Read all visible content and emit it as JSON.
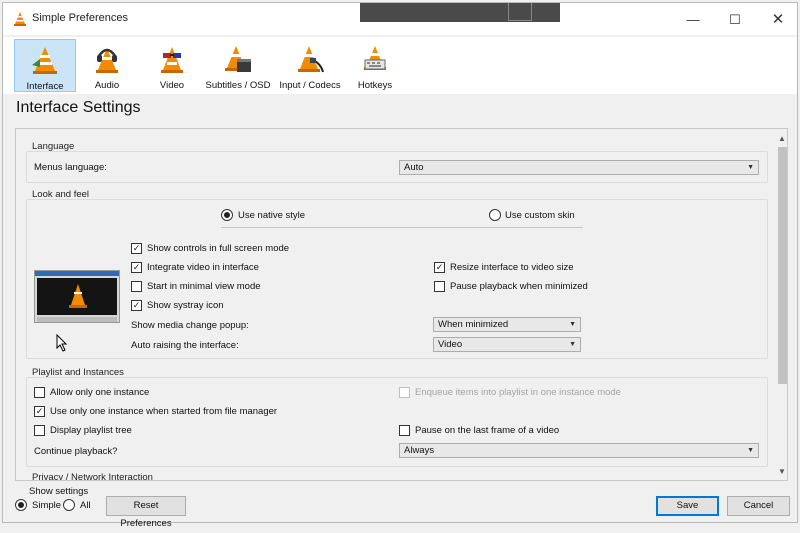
{
  "window": {
    "title": "Simple Preferences"
  },
  "toolbar": {
    "items": [
      {
        "label": "Interface",
        "icon": "cone-interface-icon"
      },
      {
        "label": "Audio",
        "icon": "cone-headphones-icon"
      },
      {
        "label": "Video",
        "icon": "cone-glasses-icon"
      },
      {
        "label": "Subtitles / OSD",
        "icon": "cone-clapper-icon"
      },
      {
        "label": "Input / Codecs",
        "icon": "cone-plug-icon"
      },
      {
        "label": "Hotkeys",
        "icon": "cone-keyboard-icon"
      }
    ]
  },
  "page": {
    "title": "Interface Settings"
  },
  "language": {
    "section": "Language",
    "menus_label": "Menus language:",
    "menus_value": "Auto"
  },
  "look": {
    "section": "Look and feel",
    "native_style": "Use native style",
    "custom_skin": "Use custom skin",
    "fullscreen_controls": "Show controls in full screen mode",
    "integrate_video": "Integrate video in interface",
    "resize_interface": "Resize interface to video size",
    "minimal_view": "Start in minimal view mode",
    "pause_minimized": "Pause playback when minimized",
    "systray": "Show systray icon",
    "media_popup_label": "Show media change popup:",
    "media_popup_value": "When minimized",
    "auto_raise_label": "Auto raising the interface:",
    "auto_raise_value": "Video"
  },
  "playlist": {
    "section": "Playlist and Instances",
    "one_instance": "Allow only one instance",
    "enqueue": "Enqueue items into playlist in one instance mode",
    "one_instance_file_manager": "Use only one instance when started from file manager",
    "playlist_tree": "Display playlist tree",
    "pause_last_frame": "Pause on the last frame of a video",
    "continue_label": "Continue playback?",
    "continue_value": "Always"
  },
  "privacy": {
    "section": "Privacy / Network Interaction"
  },
  "footer": {
    "show_settings": "Show settings",
    "simple": "Simple",
    "all": "All",
    "reset": "Reset Preferences",
    "save": "Save",
    "cancel": "Cancel"
  },
  "colors": {
    "accent": "#0078d7",
    "selected_tab": "#cce4f7",
    "cone_orange": "#f28b00"
  }
}
